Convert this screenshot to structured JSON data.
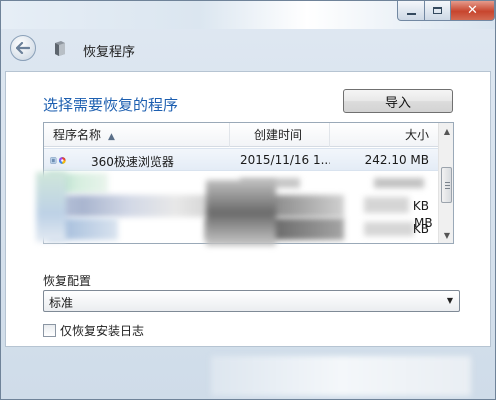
{
  "window": {
    "title": "恢复程序",
    "close_glyph": "✕"
  },
  "heading": "选择需要恢复的程序",
  "import_button": "导入",
  "list": {
    "columns": {
      "name": "程序名称",
      "date": "创建时间",
      "size": "大小"
    },
    "rows": [
      {
        "name": "360极速浏览器",
        "date": "2015/11/16 1...",
        "size": "242.10 MB",
        "icon": "360-browser-icon"
      }
    ],
    "partial_sizes": [
      "KB",
      "KB",
      "MB"
    ]
  },
  "config": {
    "label": "恢复配置",
    "selected": "标准"
  },
  "checkbox": {
    "label": "仅恢复安装日志",
    "checked": false
  },
  "colors": {
    "heading": "#1d5fb0",
    "close_button": "#c7452e"
  }
}
